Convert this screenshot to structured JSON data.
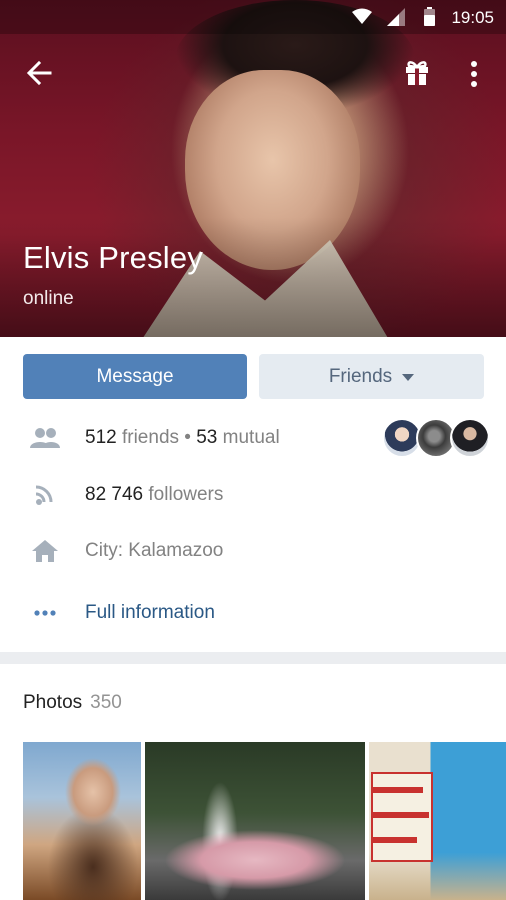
{
  "status_bar": {
    "time": "19:05"
  },
  "profile": {
    "name": "Elvis Presley",
    "status": "online"
  },
  "actions": {
    "message_label": "Message",
    "friends_label": "Friends"
  },
  "info": {
    "friends_count": "512",
    "friends_word": "friends",
    "separator": "•",
    "mutual_count": "53",
    "mutual_word": "mutual",
    "followers_count": "82 746",
    "followers_word": "followers",
    "city": "City: Kalamazoo",
    "full_information": "Full information"
  },
  "photos": {
    "title": "Photos",
    "count": "350"
  },
  "colors": {
    "accent": "#5181b8",
    "link": "#2a5885",
    "secondary_button": "#e5ebf1"
  },
  "icons": [
    "back-arrow-icon",
    "gift-icon",
    "more-vert-icon",
    "people-icon",
    "rss-icon",
    "home-icon",
    "dots-icon"
  ]
}
